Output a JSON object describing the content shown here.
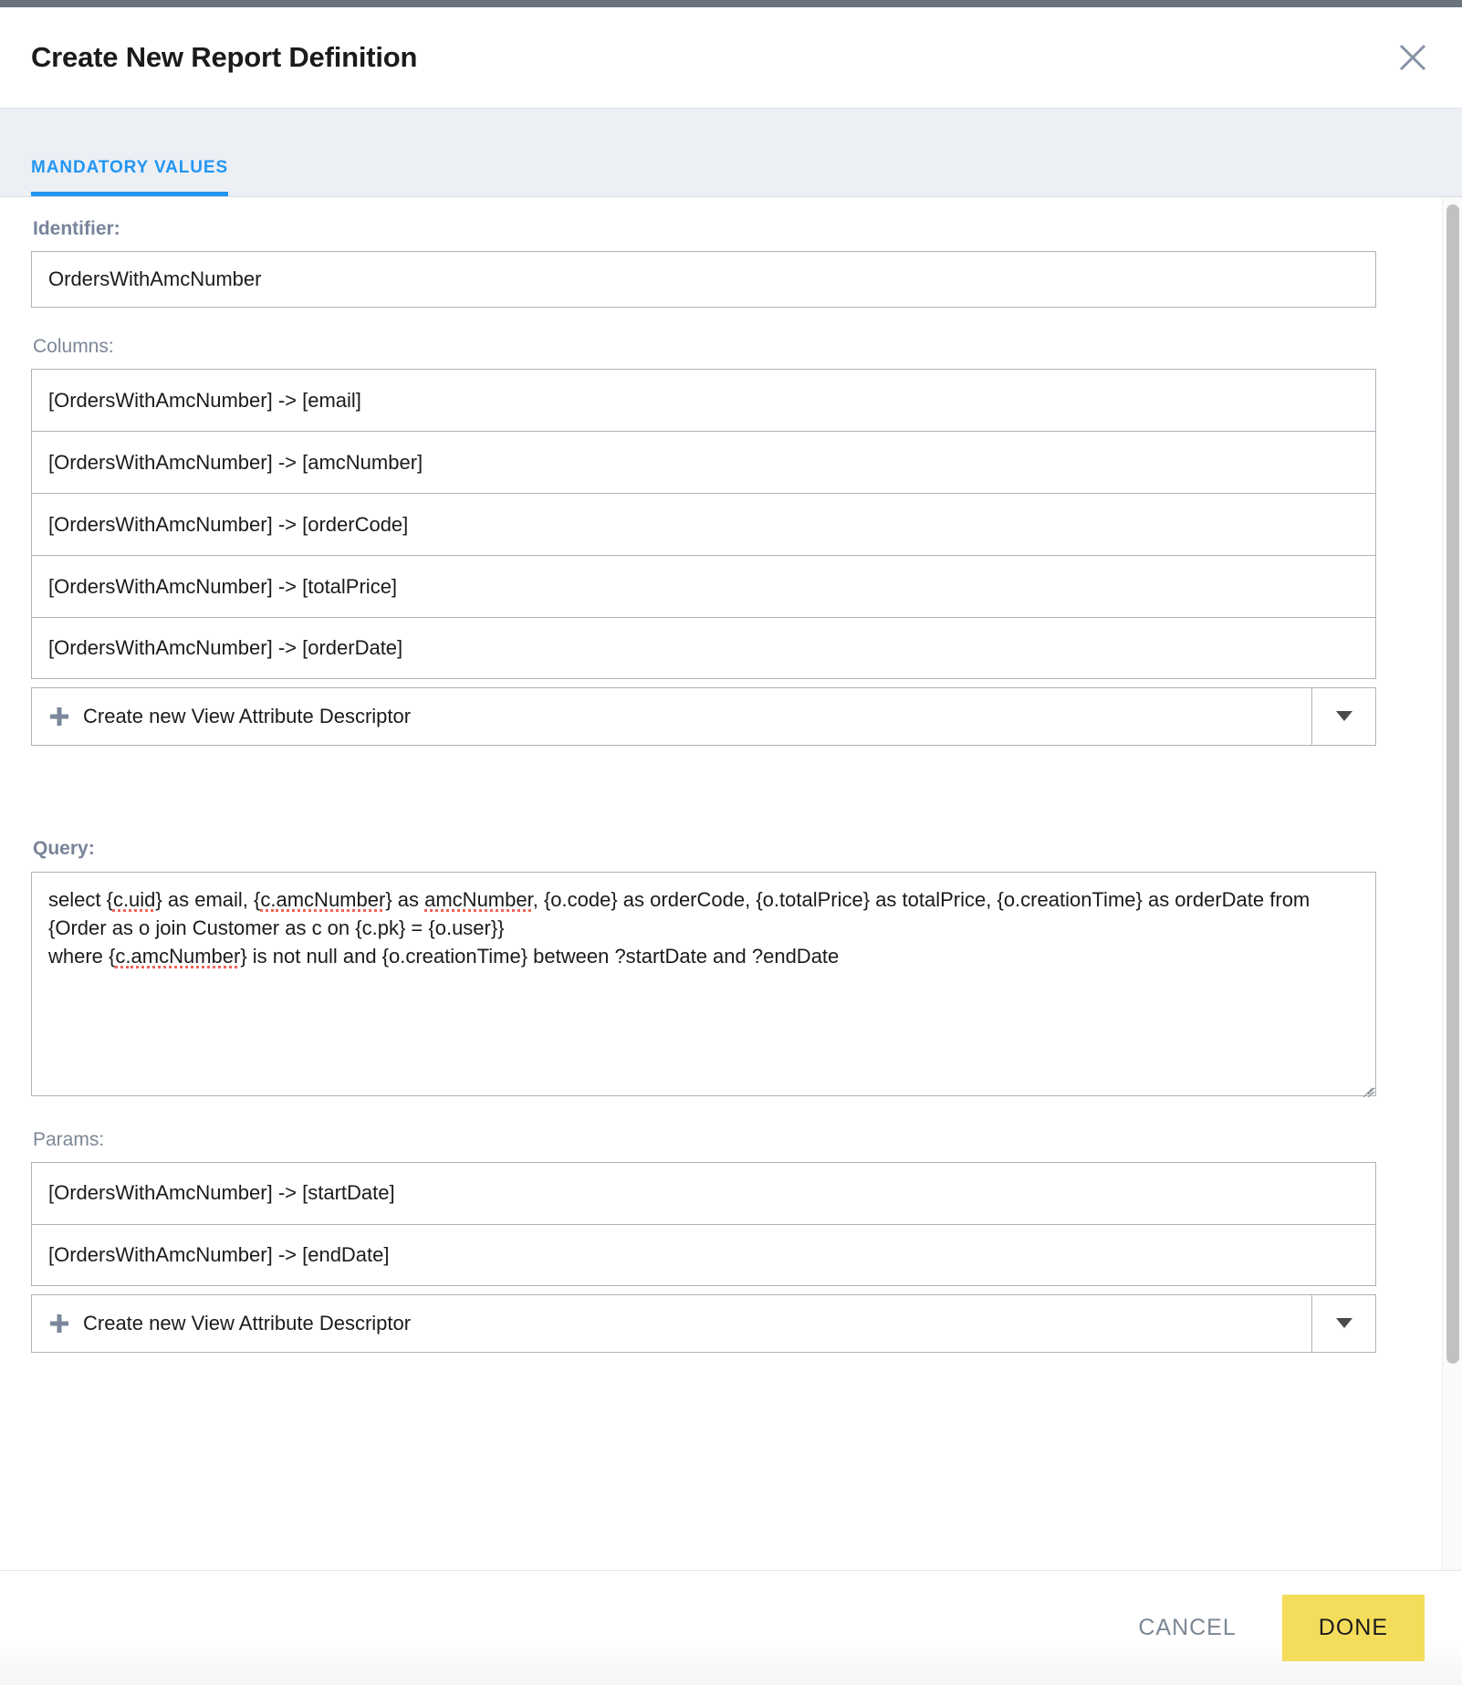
{
  "header": {
    "title": "Create New Report Definition",
    "close_icon": "close-icon"
  },
  "tabs": [
    {
      "label": "MANDATORY VALUES",
      "active": true
    }
  ],
  "form": {
    "identifier": {
      "label": "Identifier:",
      "value": "OrdersWithAmcNumber",
      "placeholder": ""
    },
    "columns": {
      "label": "Columns:",
      "items": [
        "[OrdersWithAmcNumber] -> [email]",
        "[OrdersWithAmcNumber] -> [amcNumber]",
        "[OrdersWithAmcNumber] -> [orderCode]",
        "[OrdersWithAmcNumber] -> [totalPrice]",
        "[OrdersWithAmcNumber] -> [orderDate]"
      ],
      "create_label": "Create new View Attribute Descriptor",
      "plus_icon": "plus-icon",
      "caret_icon": "chevron-down-icon"
    },
    "query": {
      "label": "Query:",
      "value": "select {c.uid} as email, {c.amcNumber} as amcNumber, {o.code} as orderCode, {o.totalPrice} as totalPrice, {o.creationTime} as orderDate from {Order as o join Customer as c on {c.pk} = {o.user}}\nwhere {c.amcNumber} is not null and {o.creationTime} between ?startDate and ?endDate",
      "placeholder": "",
      "spellcheck_terms": [
        "c.uid",
        "c.amcNumber",
        "amcNumber",
        "c.amcNumber"
      ]
    },
    "params": {
      "label": "Params:",
      "items": [
        "[OrdersWithAmcNumber] -> [startDate]",
        "[OrdersWithAmcNumber] -> [endDate]"
      ],
      "create_label": "Create new View Attribute Descriptor",
      "plus_icon": "plus-icon",
      "caret_icon": "chevron-down-icon"
    }
  },
  "footer": {
    "cancel_label": "CANCEL",
    "done_label": "DONE"
  },
  "colors": {
    "accent_blue": "#2196f3",
    "done_yellow": "#f5dd5c",
    "label_gray": "#7c8798",
    "border_gray": "#aeb3ba",
    "tab_bg": "#eceff4",
    "top_strip": "#6a737d",
    "spell_underline": "#f4645a"
  }
}
